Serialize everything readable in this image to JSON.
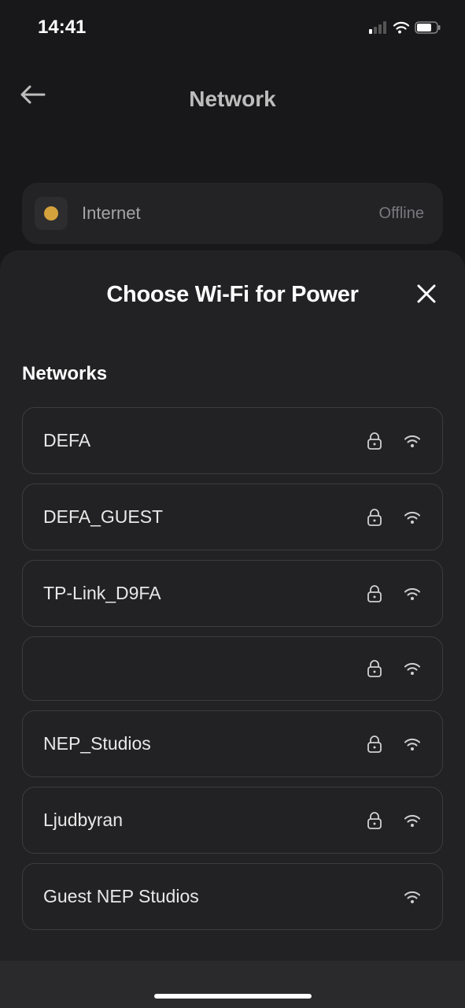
{
  "status_bar": {
    "time": "14:41"
  },
  "header": {
    "title": "Network"
  },
  "internet_card": {
    "label": "Internet",
    "status": "Offline"
  },
  "modal": {
    "title": "Choose Wi-Fi for Power",
    "section_label": "Networks",
    "networks": [
      {
        "name": "DEFA",
        "locked": true
      },
      {
        "name": "DEFA_GUEST",
        "locked": true
      },
      {
        "name": "TP-Link_D9FA",
        "locked": true
      },
      {
        "name": "",
        "locked": true
      },
      {
        "name": "NEP_Studios",
        "locked": true
      },
      {
        "name": "Ljudbyran",
        "locked": true
      },
      {
        "name": "Guest NEP Studios",
        "locked": false
      }
    ]
  }
}
